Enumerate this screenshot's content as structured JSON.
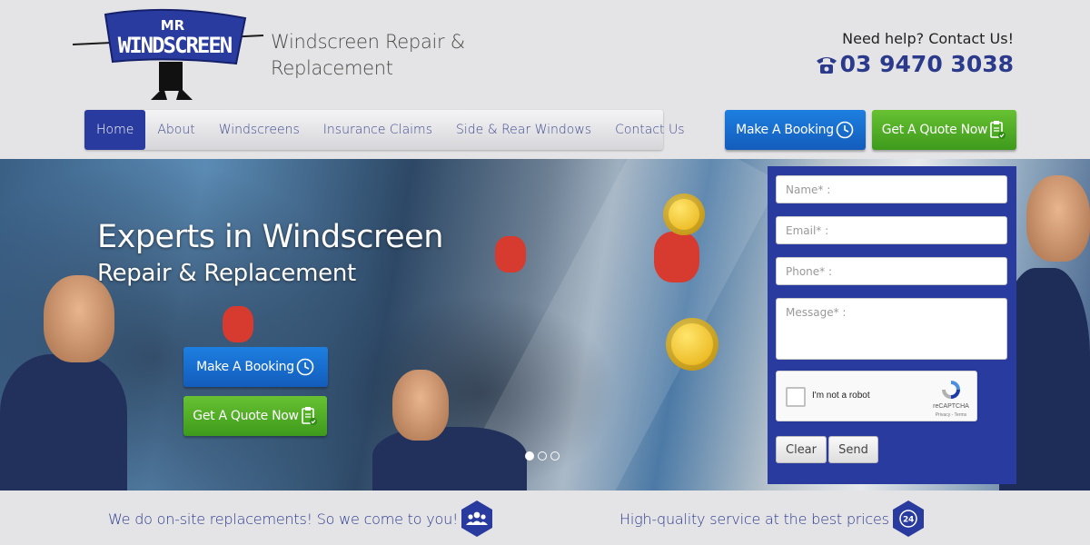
{
  "brand": {
    "logo_top": "MR",
    "logo_main": "WINDSCREEN",
    "tagline": "Windscreen Repair & Replacement"
  },
  "contact": {
    "help_text": "Need help? Contact Us!",
    "phone": "03 9470 3038",
    "phone_icon": "telephone-icon"
  },
  "nav": {
    "items": [
      {
        "label": "Home",
        "active": true
      },
      {
        "label": "About"
      },
      {
        "label": "Windscreens"
      },
      {
        "label": "Insurance Claims"
      },
      {
        "label": "Side & Rear Windows"
      },
      {
        "label": "Contact Us"
      }
    ]
  },
  "cta": {
    "booking_label": "Make A Booking",
    "quote_label": "Get A Quote Now",
    "booking_icon": "clock-icon",
    "quote_icon": "clipboard-check-icon"
  },
  "hero": {
    "headline": "Experts in Windscreen",
    "subheadline": "Repair & Replacement",
    "booking_label": "Make A Booking",
    "quote_label": "Get A Quote Now",
    "slide_count": 3,
    "active_slide": 1
  },
  "form": {
    "name_placeholder": "Name* :",
    "email_placeholder": "Email* :",
    "phone_placeholder": "Phone* :",
    "message_placeholder": "Message* :",
    "captcha_label": "I'm not a robot",
    "captcha_brand": "reCAPTCHA",
    "captcha_links": "Privacy - Terms",
    "clear_label": "Clear",
    "send_label": "Send"
  },
  "features": [
    {
      "text": "We do on-site replacements! So we come to you!",
      "icon": "people-group-icon"
    },
    {
      "text": "High-quality service at the best prices",
      "icon": "phone-24-icon"
    }
  ],
  "colors": {
    "primary": "#2a3ba0",
    "accent_blue": "#1a72d4",
    "accent_green": "#52ae26",
    "background": "#e4e4e6"
  }
}
